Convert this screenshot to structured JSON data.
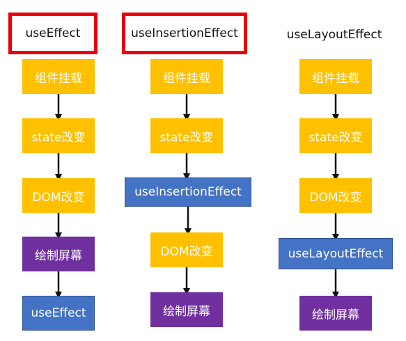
{
  "colors": {
    "yellow": "#ffc000",
    "blue": "#4472c4",
    "purple": "#7030a0",
    "highlight": "#e8000b",
    "arrow": "#111111"
  },
  "columns": [
    {
      "title": "useEffect",
      "highlighted": true,
      "steps": [
        {
          "label": "组件挂载",
          "color": "yellow"
        },
        {
          "label": "state改变",
          "color": "yellow"
        },
        {
          "label": "DOM改变",
          "color": "yellow"
        },
        {
          "label": "绘制屏幕",
          "color": "purple"
        },
        {
          "label": "useEffect",
          "color": "blue"
        }
      ]
    },
    {
      "title": "useInsertionEffect",
      "highlighted": true,
      "steps": [
        {
          "label": "组件挂载",
          "color": "yellow"
        },
        {
          "label": "state改变",
          "color": "yellow"
        },
        {
          "label": "useInsertionEffect",
          "color": "blue"
        },
        {
          "label": "DOM改变",
          "color": "yellow"
        },
        {
          "label": "绘制屏幕",
          "color": "purple"
        }
      ]
    },
    {
      "title": "useLayoutEffect",
      "highlighted": false,
      "steps": [
        {
          "label": "组件挂载",
          "color": "yellow"
        },
        {
          "label": "state改变",
          "color": "yellow"
        },
        {
          "label": "DOM改变",
          "color": "yellow"
        },
        {
          "label": "useLayoutEffect",
          "color": "blue"
        },
        {
          "label": "绘制屏幕",
          "color": "purple"
        }
      ]
    }
  ]
}
